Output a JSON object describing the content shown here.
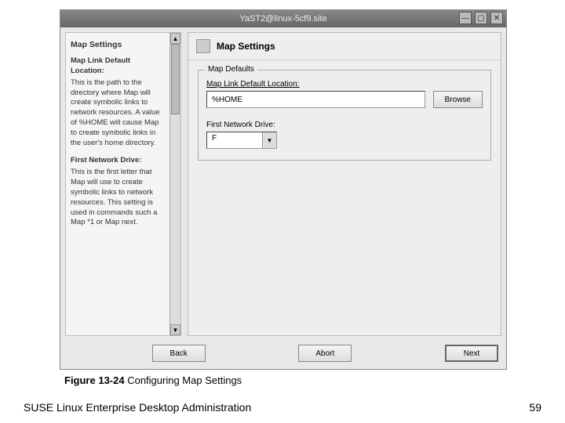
{
  "window": {
    "title": "YaST2@linux-5cf9.site"
  },
  "help": {
    "title": "Map Settings",
    "section1_title": "Map Link Default Location:",
    "section1_text": "This is the path to the directory where Map will create symbolic links to network resources. A value of %HOME will cause Map to create symbolic links in the user's home directory.",
    "section2_title": "First Network Drive:",
    "section2_text": "This is the first letter that Map will use to create symbolic links to network resources. This setting is used in commands such a Map *1 or Map next."
  },
  "main": {
    "title": "Map Settings",
    "fieldset_legend": "Map Defaults",
    "location_label": "Map Link Default Location:",
    "location_value": "%HOME",
    "browse_label": "Browse",
    "drive_label": "First Network Drive:",
    "drive_value": "F"
  },
  "buttons": {
    "back": "Back",
    "abort": "Abort",
    "next": "Next"
  },
  "caption": {
    "fig": "Figure 13-24",
    "text": " Configuring Map Settings"
  },
  "footer": {
    "left": "SUSE Linux Enterprise Desktop Administration",
    "right": "59"
  }
}
